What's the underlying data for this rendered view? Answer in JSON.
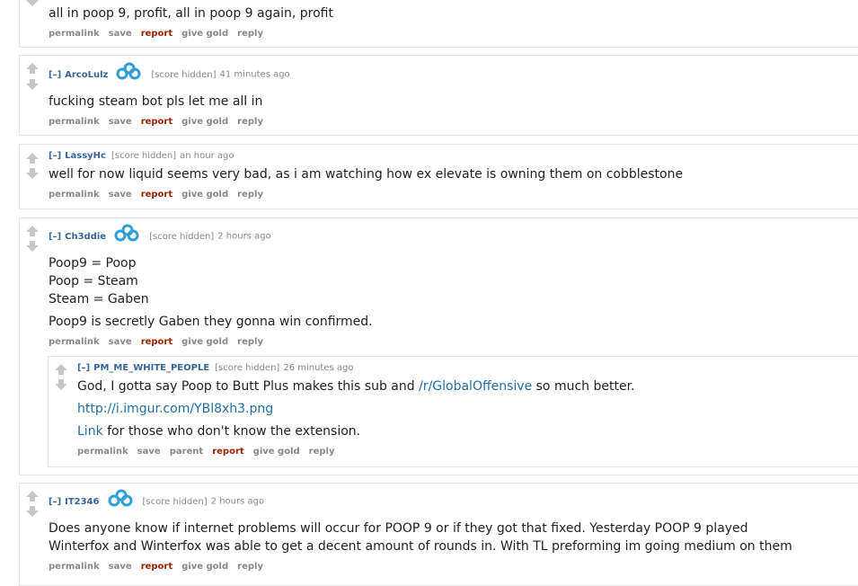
{
  "c0": {
    "body": [
      "all in poop 9, profit, all in poop 9 again, profit"
    ],
    "buttons": {
      "permalink": "permalink",
      "save": "save",
      "report": "report",
      "give_gold": "give gold",
      "reply": "reply"
    }
  },
  "c1": {
    "toggle": "[–]",
    "author": "ArcoLulz",
    "score": "[score hidden]",
    "time": "41 minutes ago",
    "body": [
      "fucking steam bot pls let me all in"
    ],
    "buttons": {
      "permalink": "permalink",
      "save": "save",
      "report": "report",
      "give_gold": "give gold",
      "reply": "reply"
    }
  },
  "c2": {
    "toggle": "[–]",
    "author": "LassyHc",
    "score": "[score hidden]",
    "time": "an hour ago",
    "body": [
      "well for now liquid seems very bad, as i am watching how ex elevate is owning them on cobblestone"
    ],
    "buttons": {
      "permalink": "permalink",
      "save": "save",
      "report": "report",
      "give_gold": "give gold",
      "reply": "reply"
    }
  },
  "c3": {
    "toggle": "[–]",
    "author": "Ch3ddie",
    "score": "[score hidden]",
    "time": "2 hours ago",
    "body": [
      "Poop9 = Poop",
      "Poop = Steam",
      "Steam = Gaben",
      "Poop9 is secretly Gaben they gonna win confirmed."
    ],
    "buttons": {
      "permalink": "permalink",
      "save": "save",
      "report": "report",
      "give_gold": "give gold",
      "reply": "reply"
    }
  },
  "c4": {
    "toggle": "[–]",
    "author": "PM_ME_WHITE_PEOPLE",
    "score": "[score hidden]",
    "time": "26 minutes ago",
    "line1_pre": "God, I gotta say Poop to Butt Plus makes this sub and ",
    "line1_link": "/r/GlobalOffensive",
    "line1_post": " so much better.",
    "line2_link": "http://i.imgur.com/YBl8xh3.png",
    "line3_link": "Link",
    "line3_post": " for those who don't know the extension.",
    "buttons": {
      "permalink": "permalink",
      "save": "save",
      "parent": "parent",
      "report": "report",
      "give_gold": "give gold",
      "reply": "reply"
    }
  },
  "c5": {
    "toggle": "[–]",
    "author": "IT2346",
    "score": "[score hidden]",
    "time": "2 hours ago",
    "body": [
      "Does anyone know if internet problems will occur for POOP 9 or if they got that fixed. Yesterday POOP 9 played",
      "Winterfox and Winterfox was able to get a decent amount of rounds in. With TL preforming im going medium on them"
    ],
    "buttons": {
      "permalink": "permalink",
      "save": "save",
      "report": "report",
      "give_gold": "give gold",
      "reply": "reply"
    }
  },
  "colors": {
    "link": "#1f6ea8",
    "author": "#336699",
    "report": "#9a2400",
    "flair": "#2e9fd6",
    "muted": "#888888"
  },
  "icons": {
    "upvote": "upvote-arrow-icon",
    "downvote": "downvote-arrow-icon",
    "flair": "cloud9-flair-icon"
  }
}
